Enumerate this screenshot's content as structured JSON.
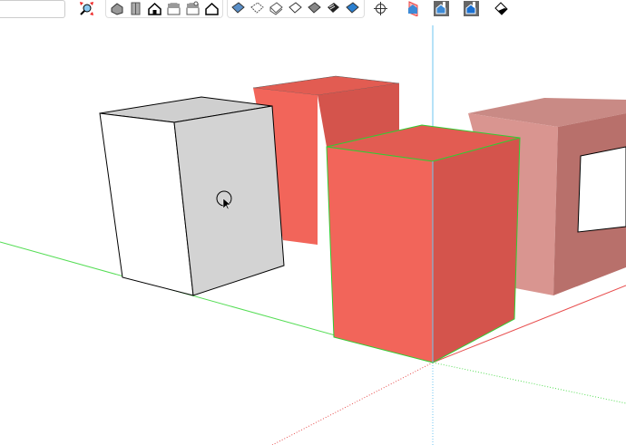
{
  "toolbar": {
    "measurements_value": "",
    "camera": [
      "zoom-extents-icon"
    ],
    "views": [
      "iso-view-icon",
      "top-view-icon",
      "front-view-icon",
      "right-view-icon",
      "back-view-icon",
      "left-view-icon"
    ],
    "styles": [
      "xray-icon",
      "back-edges-icon",
      "wireframe-icon",
      "hidden-line-icon",
      "shaded-icon",
      "shaded-textures-icon",
      "monochrome-icon"
    ],
    "tools": [
      "section-plane-icon",
      "display-section-planes-icon",
      "display-section-cuts-icon",
      "display-section-fill-icon",
      "paint-bucket-icon"
    ]
  },
  "colors": {
    "red_box": "#f2655a",
    "red_side": "#d4544c",
    "highlight": "#33cc33",
    "axis_blue": "#6ec6f0",
    "axis_green": "#55dd55",
    "axis_red": "#e84c4c"
  }
}
